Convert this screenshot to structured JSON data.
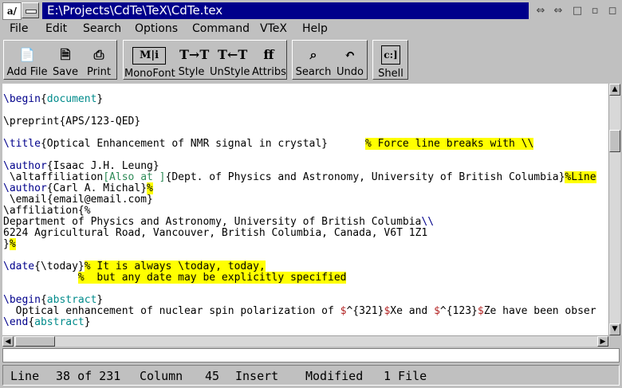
{
  "window": {
    "title": "E:\\Projects\\CdTe\\TeX\\CdTe.tex",
    "app_icon_text": "a/",
    "buttons": [
      "restore-icon",
      "restore2-icon",
      "minimize-icon",
      "maximize-icon",
      "close-icon"
    ]
  },
  "menu": [
    "File",
    "Edit",
    "Search",
    "Options",
    "Command",
    "VTeX",
    "Help"
  ],
  "toolbar": {
    "add_file": "Add File",
    "save": "Save",
    "print": "Print",
    "monofont": "MonoFont",
    "style": "Style",
    "unstyle": "UnStyle",
    "attribs": "Attribs",
    "search": "Search",
    "undo": "Undo",
    "shell": "Shell",
    "monofont_icon": "M|i",
    "style_icon": "T→T",
    "unstyle_icon": "T←T",
    "attribs_icon": "ff",
    "shell_icon": "c:]"
  },
  "editor": {
    "lines": [
      [
        {
          "c": "cmd",
          "t": "\\begin"
        },
        {
          "c": "",
          "t": "{"
        },
        {
          "c": "arg",
          "t": "document"
        },
        {
          "c": "",
          "t": "}"
        }
      ],
      [],
      [
        {
          "c": "",
          "t": "\\preprint{APS/123-QED}"
        }
      ],
      [],
      [
        {
          "c": "cmd",
          "t": "\\title"
        },
        {
          "c": "",
          "t": "{Optical Enhancement of NMR signal in crystal}      "
        },
        {
          "c": "cmt",
          "t": "% Force line breaks with \\\\"
        }
      ],
      [],
      [
        {
          "c": "cmd",
          "t": "\\author"
        },
        {
          "c": "",
          "t": "{Isaac J.H. Leung}"
        }
      ],
      [
        {
          "c": "",
          "t": " \\altaffiliation"
        },
        {
          "c": "opt",
          "t": "[Also at ]"
        },
        {
          "c": "",
          "t": "{Dept. of Physics and Astronomy, University of British Columbia}"
        },
        {
          "c": "cmt",
          "t": "%Line"
        }
      ],
      [
        {
          "c": "cmd",
          "t": "\\author"
        },
        {
          "c": "",
          "t": "{Carl A. Michal}"
        },
        {
          "c": "cmt",
          "t": "%"
        }
      ],
      [
        {
          "c": "",
          "t": " \\email{email@email.com}"
        }
      ],
      [
        {
          "c": "",
          "t": "\\affiliation{%"
        }
      ],
      [
        {
          "c": "",
          "t": "Department of Physics and Astronomy, University of British Columbia"
        },
        {
          "c": "cmd",
          "t": "\\\\"
        }
      ],
      [
        {
          "c": "",
          "t": "6224 Agricultural Road, Vancouver, British Columbia, Canada, V6T 1Z1"
        }
      ],
      [
        {
          "c": "",
          "t": "}"
        },
        {
          "c": "cmt",
          "t": "%"
        }
      ],
      [],
      [
        {
          "c": "cmd",
          "t": "\\date"
        },
        {
          "c": "",
          "t": "{\\today}"
        },
        {
          "c": "cmt",
          "t": "% It is always \\today, today,"
        }
      ],
      [
        {
          "c": "",
          "t": "            "
        },
        {
          "c": "cmt",
          "t": "%  but any date may be explicitly specified"
        }
      ],
      [],
      [
        {
          "c": "cmd",
          "t": "\\begin"
        },
        {
          "c": "",
          "t": "{"
        },
        {
          "c": "arg",
          "t": "abstract"
        },
        {
          "c": "",
          "t": "}"
        }
      ],
      [
        {
          "c": "",
          "t": "  Optical enhancement of nuclear spin polarization of "
        },
        {
          "c": "dol",
          "t": "$"
        },
        {
          "c": "",
          "t": "^{321}"
        },
        {
          "c": "dol",
          "t": "$"
        },
        {
          "c": "",
          "t": "Xe and "
        },
        {
          "c": "dol",
          "t": "$"
        },
        {
          "c": "",
          "t": "^{123}"
        },
        {
          "c": "dol",
          "t": "$"
        },
        {
          "c": "",
          "t": "Ze have been obser"
        }
      ],
      [
        {
          "c": "cmd",
          "t": "\\end"
        },
        {
          "c": "",
          "t": "{"
        },
        {
          "c": "arg",
          "t": "abstract"
        },
        {
          "c": "",
          "t": "}"
        }
      ]
    ]
  },
  "status": {
    "line_label": "Line",
    "line_value": "38 of 231",
    "column_label": "Column",
    "column_value": "45",
    "mode": "Insert",
    "modified": "Modified",
    "files": "1 File"
  },
  "colors": {
    "title_active": "#00008b",
    "command": "#00008b",
    "argument": "#008b8b",
    "option": "#2e8b57",
    "math": "#b22222",
    "comment_bg": "#ffff00"
  }
}
